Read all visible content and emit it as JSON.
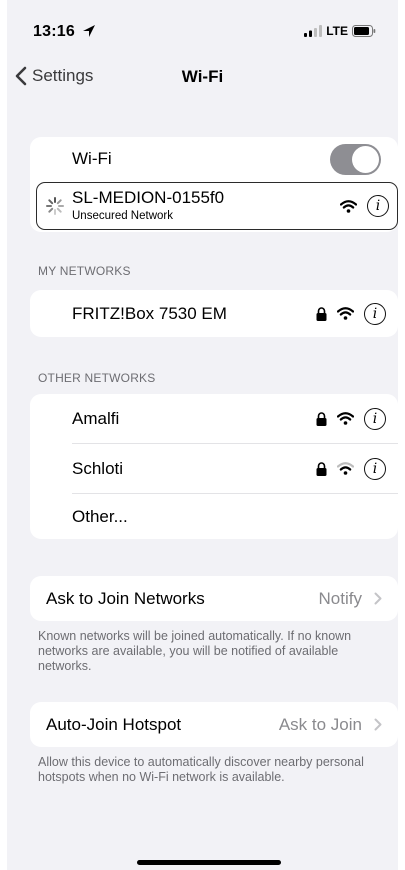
{
  "status": {
    "time": "13:16",
    "network": "LTE"
  },
  "nav": {
    "back_label": "Settings",
    "title": "Wi-Fi"
  },
  "wifi": {
    "label": "Wi-Fi",
    "connected": {
      "name": "SL-MEDION-0155f0",
      "subtitle": "Unsecured Network"
    }
  },
  "my_networks": {
    "header": "MY NETWORKS",
    "items": [
      {
        "name": "FRITZ!Box 7530 EM"
      }
    ]
  },
  "other_networks": {
    "header": "OTHER NETWORKS",
    "items": [
      {
        "name": "Amalfi"
      },
      {
        "name": "Schloti"
      }
    ],
    "other_label": "Other..."
  },
  "ask_to_join": {
    "label": "Ask to Join Networks",
    "value": "Notify",
    "footer": "Known networks will be joined automatically. If no known networks are available, you will be notified of available networks."
  },
  "auto_join": {
    "label": "Auto-Join Hotspot",
    "value": "Ask to Join",
    "footer": "Allow this device to automatically discover nearby personal hotspots when no Wi-Fi network is available."
  }
}
